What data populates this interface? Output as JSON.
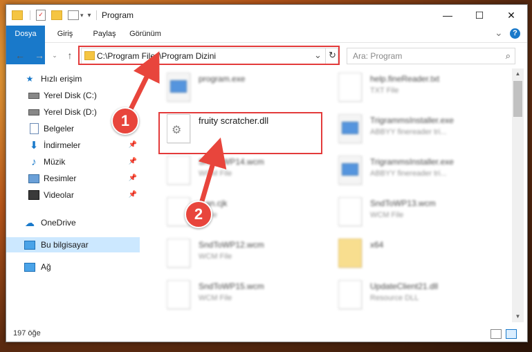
{
  "window": {
    "title": "Program",
    "controls": {
      "minimize": "—",
      "maximize": "☐",
      "close": "✕"
    }
  },
  "ribbon": {
    "tabs": [
      "Dosya",
      "Giriş",
      "Paylaş",
      "Görünüm"
    ],
    "expand": "⌄",
    "help": "?"
  },
  "address": {
    "path": "C:\\Program Files\\Program Dizini",
    "dropdown": "⌄",
    "refresh": "↻"
  },
  "search": {
    "placeholder": "Ara: Program"
  },
  "sidebar": {
    "items": [
      {
        "label": "Hızlı erişim",
        "icon": "star-icon"
      },
      {
        "label": "Yerel Disk (C:)",
        "icon": "drive-icon"
      },
      {
        "label": "Yerel Disk (D:)",
        "icon": "drive-icon"
      },
      {
        "label": "Belgeler",
        "icon": "documents-icon"
      },
      {
        "label": "İndirmeler",
        "icon": "downloads-icon"
      },
      {
        "label": "Müzik",
        "icon": "music-icon"
      },
      {
        "label": "Resimler",
        "icon": "pictures-icon"
      },
      {
        "label": "Videolar",
        "icon": "videos-icon"
      },
      {
        "label": "OneDrive",
        "icon": "cloud-icon"
      },
      {
        "label": "Bu bilgisayar",
        "icon": "computer-icon"
      },
      {
        "label": "Ağ",
        "icon": "network-icon"
      }
    ]
  },
  "files": [
    {
      "name": "program.exe",
      "type": ""
    },
    {
      "name": "help.fineReader.txt",
      "type": "TXT File"
    },
    {
      "name": "fruity scratcher.dll",
      "type": ""
    },
    {
      "name": "TrigrammsInstaller.exe",
      "type": "ABBYY finereader tri..."
    },
    {
      "name": "SndToWP14.wcm",
      "type": "WCM File"
    },
    {
      "name": "TrigrammsInstaller.exe",
      "type": "ABBYY finereader tri..."
    },
    {
      "name": "...an.cjk",
      "type": "...File"
    },
    {
      "name": "SndToWP13.wcm",
      "type": "WCM File"
    },
    {
      "name": "SndToWP12.wcm",
      "type": "WCM File"
    },
    {
      "name": "x64",
      "type": ""
    },
    {
      "name": "SndToWP15.wcm",
      "type": "WCM File"
    },
    {
      "name": "UpdateClient21.dll",
      "type": "Resource DLL"
    }
  ],
  "status": {
    "count": "197 öğe"
  },
  "annotations": {
    "marker1": "1",
    "marker2": "2"
  },
  "colors": {
    "accent": "#1979ca",
    "highlight": "#e33a3a",
    "selected": "#cce8ff"
  }
}
